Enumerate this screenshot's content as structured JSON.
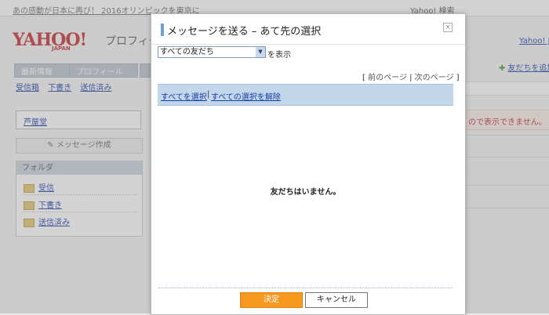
{
  "background": {
    "news_text": "あの感動が日本に再び！ 2016オリンピックを東京に",
    "top_right_label": "Yahoo! 検索",
    "logo_text": "YAHOO!",
    "logo_sub": "JAPAN",
    "page_title": "プロフィー",
    "tabs": [
      "最新情報",
      "プロフィール",
      ""
    ],
    "subnav": [
      "受信箱",
      "下書き",
      "送信済み"
    ],
    "user_name": "芦屋堂",
    "compose_button": "メッセージ作成",
    "folder_header": "フォルダ",
    "folders": [
      "受信",
      "下書き",
      "送信済み"
    ],
    "right_link_top": "Yahoo! J",
    "right_link_add": "友だちを追加",
    "right_warning": "ので表示できません。"
  },
  "dialog": {
    "title": "メッセージを送る – あて先の選択",
    "close_symbol": "×",
    "filter": {
      "selected": "すべての友だち",
      "suffix": "を表示"
    },
    "pager": {
      "open": "[ ",
      "prev": "前のページ",
      "sep": " | ",
      "next": "次のページ",
      "close": " ]"
    },
    "select_all": "すべてを選択",
    "select_sep": "|",
    "deselect_all": "すべての選択を解除",
    "empty_message": "友だちはいません。",
    "send_button": "決定",
    "cancel_button": "キャンセル"
  },
  "colors": {
    "accent_orange": "#f79920",
    "select_bar": "#c3d7ea",
    "link": "#1a3ca8",
    "logo_red": "#c4242b"
  }
}
